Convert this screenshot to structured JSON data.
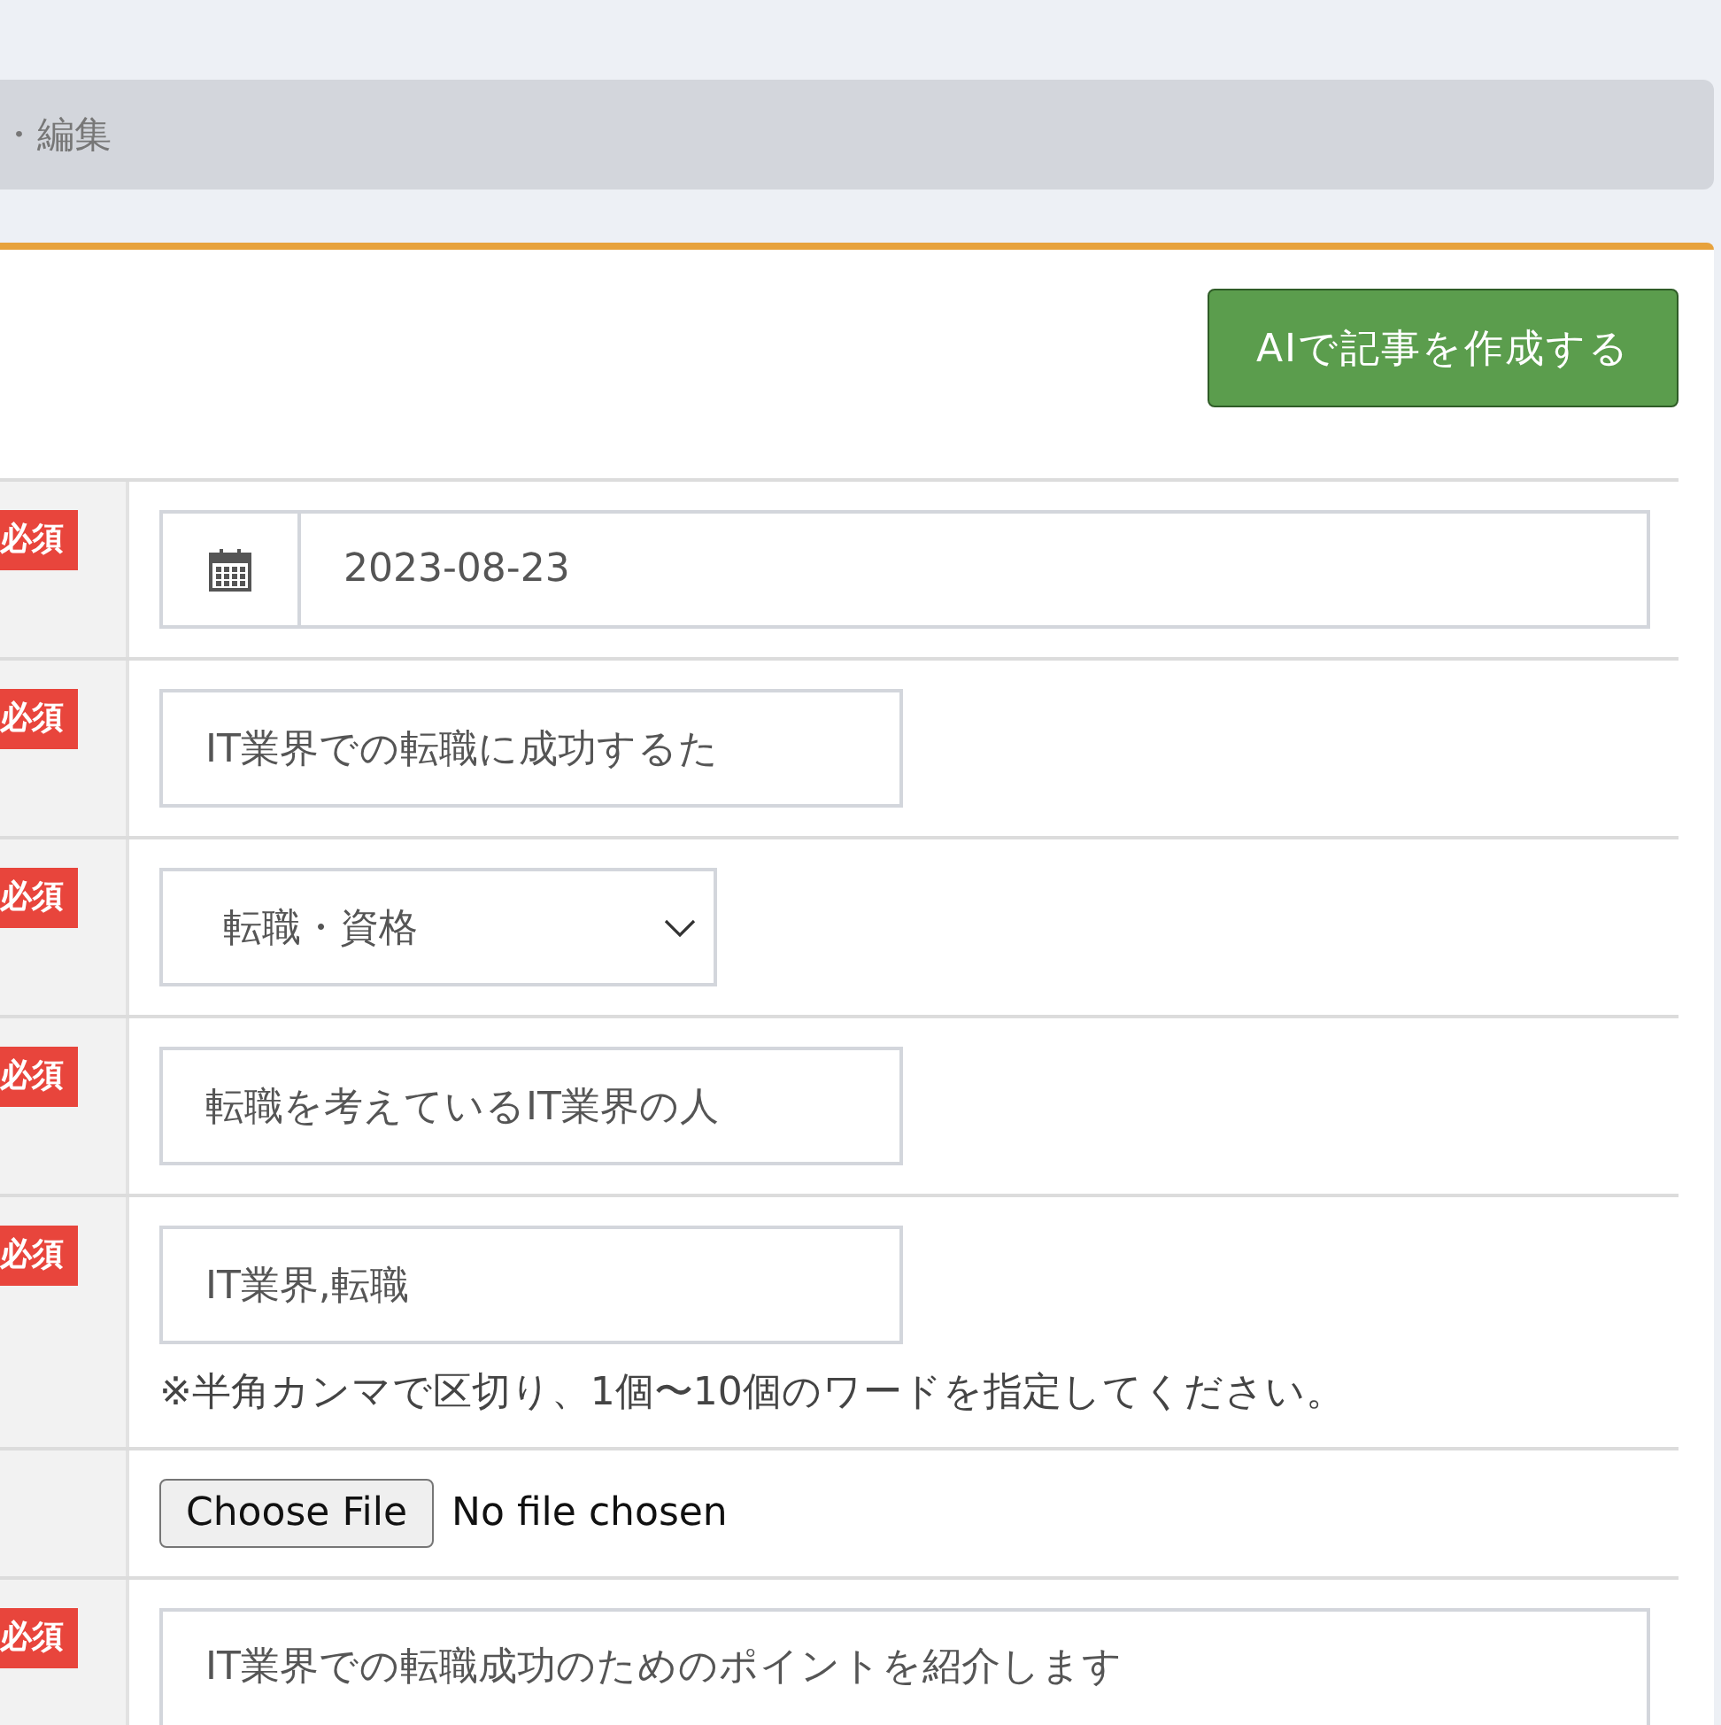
{
  "breadcrumb": "・編集",
  "generate_button": "AIで記事を作成する",
  "rows": [
    {
      "kind": "date",
      "badge": "必須",
      "value": "2023-08-23"
    },
    {
      "kind": "text",
      "badge": "必須",
      "value": "IT業界での転職に成功するた"
    },
    {
      "kind": "select",
      "badge": "必須",
      "value": "転職・資格"
    },
    {
      "kind": "text",
      "badge": "必須",
      "value": "転職を考えているIT業界の人"
    },
    {
      "kind": "text",
      "badge": "必須",
      "value": "IT業界,転職",
      "note": "※半角カンマで区切り、1個〜10個のワードを指定してください。"
    },
    {
      "kind": "file",
      "button": "Choose File",
      "status": "No file chosen"
    },
    {
      "kind": "textarea",
      "badge": "必須",
      "value": "IT業界での転職成功のためのポイントを紹介します"
    }
  ]
}
